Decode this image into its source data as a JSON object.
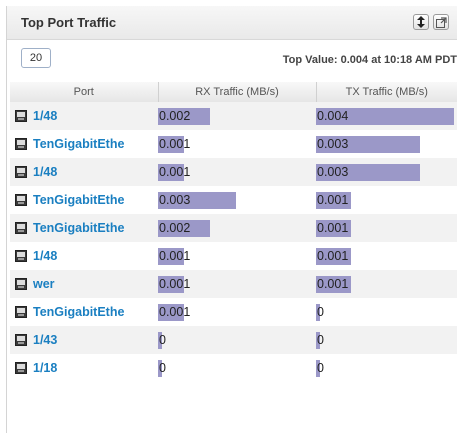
{
  "widget": {
    "title": "Top Port Traffic",
    "count": "20",
    "top_value": "Top Value: 0.004 at 10:18 AM PDT"
  },
  "icons": {
    "sort": "sort-icon",
    "popout": "popout-icon",
    "port": "port-icon"
  },
  "colors": {
    "bar": "#9b98c8",
    "link": "#1a7fc1",
    "header_bg": "#eeeeee"
  },
  "table": {
    "headers": [
      "Port",
      "RX Traffic (MB/s)",
      "TX Traffic (MB/s)"
    ],
    "rows": [
      {
        "port": "1/48",
        "rx": "0.002",
        "tx": "0.004"
      },
      {
        "port": "TenGigabitEthe",
        "rx": "0.001",
        "tx": "0.003"
      },
      {
        "port": "1/48",
        "rx": "0.001",
        "tx": "0.003"
      },
      {
        "port": "TenGigabitEthe",
        "rx": "0.003",
        "tx": "0.001"
      },
      {
        "port": "TenGigabitEthe",
        "rx": "0.002",
        "tx": "0.001"
      },
      {
        "port": "1/48",
        "rx": "0.001",
        "tx": "0.001"
      },
      {
        "port": "wer",
        "rx": "0.001",
        "tx": "0.001"
      },
      {
        "port": "TenGigabitEthe",
        "rx": "0.001",
        "tx": "0"
      },
      {
        "port": "1/43",
        "rx": "0",
        "tx": "0"
      },
      {
        "port": "1/18",
        "rx": "0",
        "tx": "0"
      }
    ]
  }
}
